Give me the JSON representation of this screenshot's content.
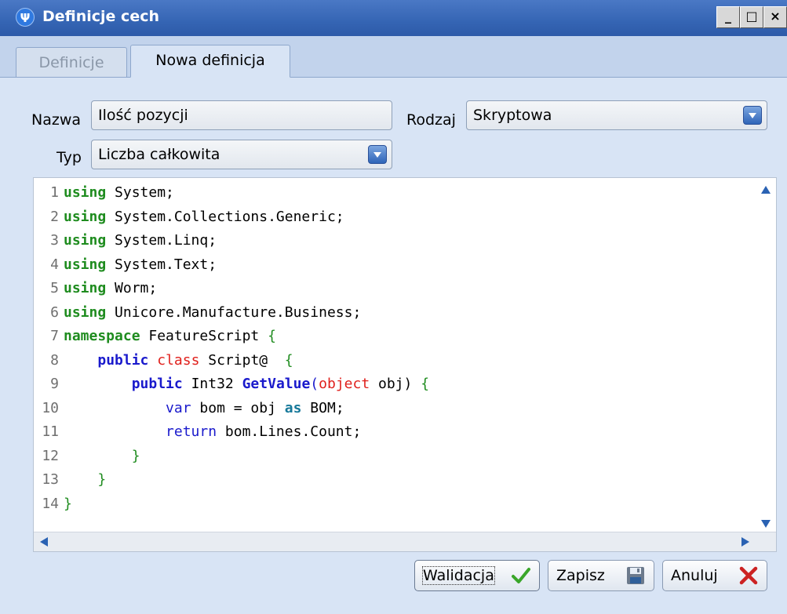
{
  "window": {
    "icon_text": "Ψ",
    "title": "Definicje cech",
    "buttons": [
      "_",
      "□",
      "×"
    ]
  },
  "tabs": [
    {
      "label": "Definicje",
      "active": false
    },
    {
      "label": "Nowa definicja",
      "active": true
    }
  ],
  "form": {
    "name_label": "Nazwa",
    "name_value": "Ilość pozycji",
    "kind_label": "Rodzaj",
    "kind_value": "Skryptowa",
    "type_label": "Typ",
    "type_value": "Liczba całkowita"
  },
  "editor": {
    "line_numbers": [
      "1",
      "2",
      "3",
      "4",
      "5",
      "6",
      "7",
      "8",
      "9",
      "10",
      "11",
      "12",
      "13",
      "14"
    ],
    "code": [
      {
        "kw": "using",
        "rest": " System;"
      },
      {
        "kw": "using",
        "rest": " System.Collections.Generic;"
      },
      {
        "kw": "using",
        "rest": " System.Linq;"
      },
      {
        "kw": "using",
        "rest": " System.Text;"
      },
      {
        "kw": "using",
        "rest": " Worm;"
      },
      {
        "kw": "using",
        "rest": " Unicore.Manufacture.Business;"
      },
      {
        "kw": "namespace",
        "rest": " FeatureScript ",
        "brace": "{"
      },
      {
        "indent": "    ",
        "kw": "public",
        "kw2": "class",
        "rest": " Script@  ",
        "brace": "{"
      },
      {
        "indent": "        ",
        "kw": "public",
        "rest": " Int32 ",
        "method": "GetValue",
        "p1": "(",
        "kw2": "object",
        "p2": " obj) ",
        "brace": "{"
      },
      {
        "indent": "            ",
        "kw": "var",
        "rest": " bom = obj ",
        "kw2": "as",
        "rest2": " BOM;"
      },
      {
        "indent": "            ",
        "kw": "return",
        "rest": " bom.Lines.Count;"
      },
      {
        "indent": "        ",
        "brace": "}"
      },
      {
        "indent": "    ",
        "brace": "}"
      },
      {
        "indent": "",
        "brace": "}"
      }
    ]
  },
  "buttons": {
    "validate": "Walidacja",
    "save": "Zapisz",
    "cancel": "Anuluj"
  },
  "icons": {
    "validate": "checkmark-icon",
    "save": "floppy-disk-icon",
    "cancel": "red-x-icon"
  }
}
